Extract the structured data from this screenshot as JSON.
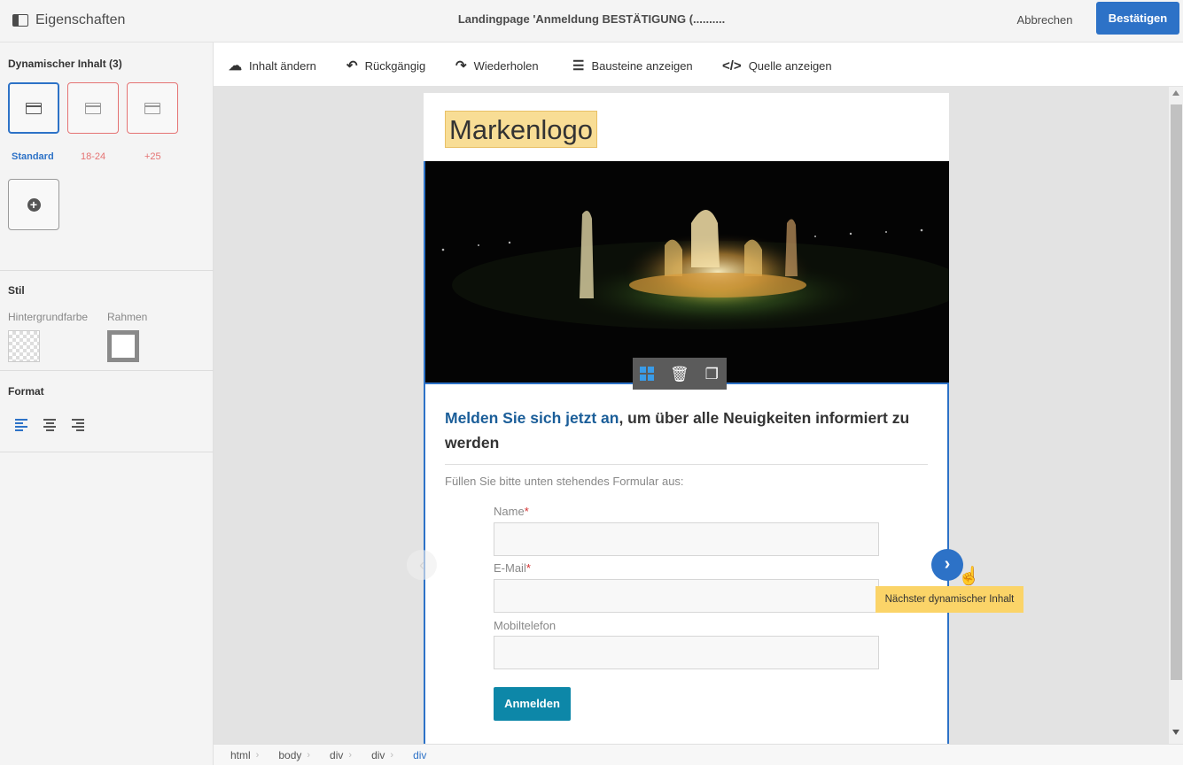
{
  "header": {
    "properties_label": "Eigenschaften",
    "title": "Landingpage 'Anmeldung BESTÄTIGUNG (..........",
    "cancel_label": "Abbrechen",
    "confirm_label": "Bestätigen"
  },
  "sidebar": {
    "dynamic_title": "Dynamischer Inhalt (3)",
    "variants": [
      {
        "label": "Standard",
        "icon": "content-block-icon",
        "active": true
      },
      {
        "label": "18-24",
        "icon": "content-block-icon",
        "active": false
      },
      {
        "label": "+25",
        "icon": "content-block-icon",
        "active": false
      }
    ],
    "style_title": "Stil",
    "bg_color_label": "Hintergrundfarbe",
    "border_label": "Rahmen",
    "format_title": "Format"
  },
  "toolbar": {
    "items": [
      {
        "label": "Inhalt ändern",
        "icon": "cloud-upload-icon"
      },
      {
        "label": "Rückgängig",
        "icon": "undo-icon"
      },
      {
        "label": "Wiederholen",
        "icon": "redo-icon"
      },
      {
        "label": "Bausteine anzeigen",
        "icon": "list-icon"
      },
      {
        "label": "Quelle anzeigen",
        "icon": "code-icon"
      }
    ]
  },
  "page": {
    "logo_text": "Markenlogo",
    "headline_highlight": "Melden Sie sich jetzt an",
    "headline_rest": ", um über alle Neuigkeiten informiert zu werden",
    "intro": "Füllen Sie bitte unten stehendes Formular aus:",
    "fields": [
      {
        "label": "Name",
        "required": true,
        "required_mark": "*"
      },
      {
        "label": "E-Mail",
        "required": true,
        "required_mark": "*"
      },
      {
        "label": "Mobiltelefon",
        "required": false,
        "required_mark": ""
      }
    ],
    "submit_label": "Anmelden"
  },
  "tooltip": "Nächster dynamischer Inhalt",
  "breadcrumb": [
    "html",
    "body",
    "div",
    "div",
    "div"
  ],
  "colors": {
    "accent": "#2d72c7",
    "submit": "#0d87a8",
    "tooltip_bg": "#fbd468",
    "variant_alt_border": "#e57373"
  }
}
